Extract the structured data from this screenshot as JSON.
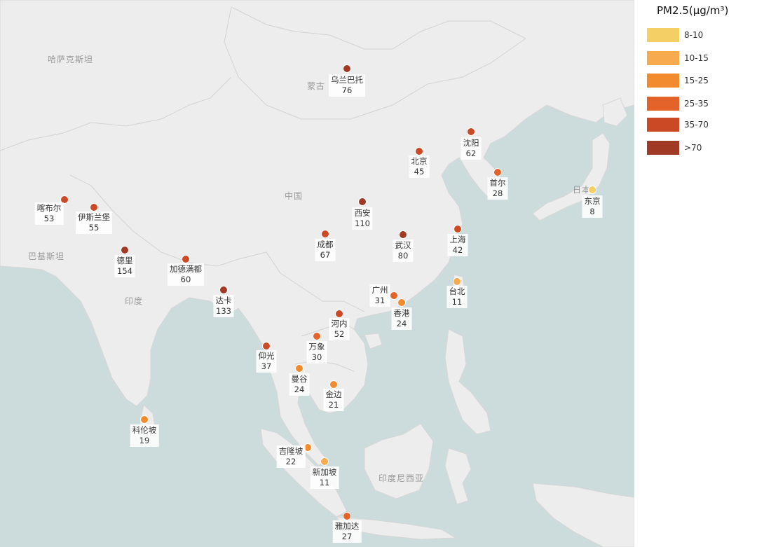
{
  "legend": {
    "title": "PM2.5(μg/m³)",
    "items": [
      {
        "label": "8-10",
        "color": "#f3cf66"
      },
      {
        "label": "10-15",
        "color": "#f8aa4e"
      },
      {
        "label": "15-25",
        "color": "#f28a2e"
      },
      {
        "label": "25-35",
        "color": "#e3632a"
      },
      {
        "label": "35-70",
        "color": "#cb4a25"
      },
      {
        "label": ">70",
        "color": "#a13a24"
      }
    ]
  },
  "country_labels": [
    "哈萨克斯坦",
    "蒙古",
    "中国",
    "巴基斯坦",
    "印度",
    "日本",
    "印度尼西亚"
  ],
  "cities": [
    {
      "name": "乌兰巴托",
      "value": "76"
    },
    {
      "name": "沈阳",
      "value": "62"
    },
    {
      "name": "北京",
      "value": "45"
    },
    {
      "name": "首尔",
      "value": "28"
    },
    {
      "name": "东京",
      "value": "8"
    },
    {
      "name": "喀布尔",
      "value": "53"
    },
    {
      "name": "伊斯兰堡",
      "value": "55"
    },
    {
      "name": "西安",
      "value": "110"
    },
    {
      "name": "成都",
      "value": "67"
    },
    {
      "name": "武汉",
      "value": "80"
    },
    {
      "name": "上海",
      "value": "42"
    },
    {
      "name": "德里",
      "value": "154"
    },
    {
      "name": "加德满都",
      "value": "60"
    },
    {
      "name": "达卡",
      "value": "133"
    },
    {
      "name": "广州",
      "value": "31"
    },
    {
      "name": "香港",
      "value": "24"
    },
    {
      "name": "台北",
      "value": "11"
    },
    {
      "name": "河内",
      "value": "52"
    },
    {
      "name": "万象",
      "value": "30"
    },
    {
      "name": "仰光",
      "value": "37"
    },
    {
      "name": "曼谷",
      "value": "24"
    },
    {
      "name": "金边",
      "value": "21"
    },
    {
      "name": "科伦坡",
      "value": "19"
    },
    {
      "name": "吉隆坡",
      "value": "22"
    },
    {
      "name": "新加坡",
      "value": "11"
    },
    {
      "name": "雅加达",
      "value": "27"
    }
  ]
}
